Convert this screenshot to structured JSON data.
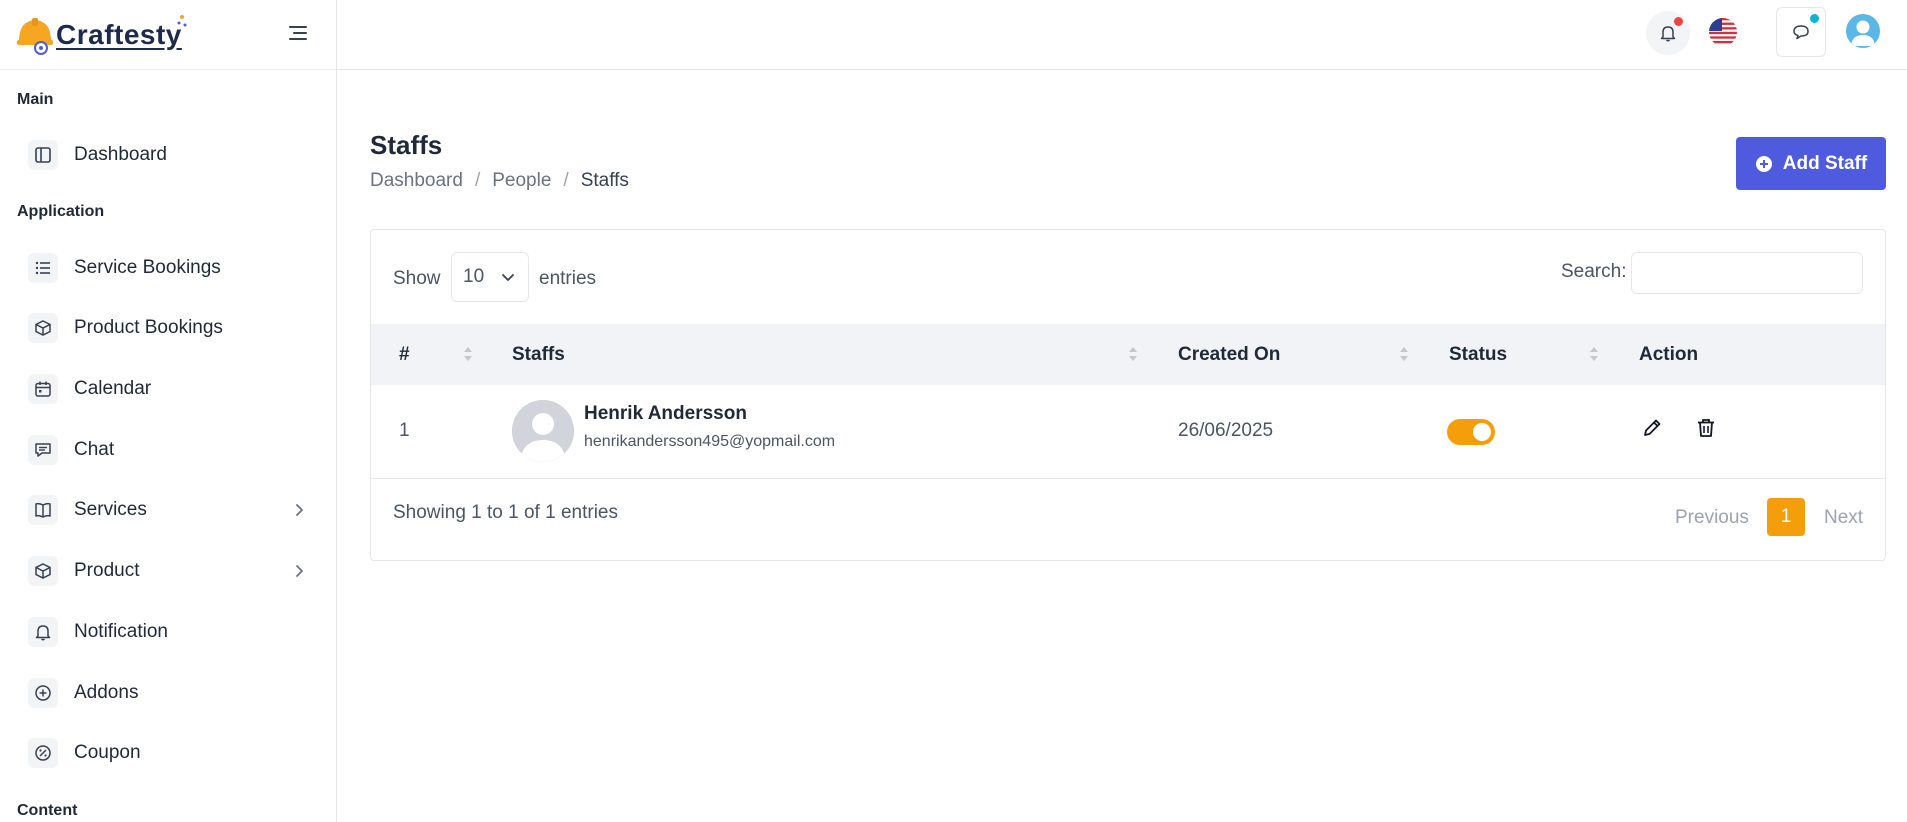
{
  "brand": {
    "name": "Craftesty"
  },
  "sidebar": {
    "sections": [
      {
        "title": "Main"
      },
      {
        "title": "Application"
      },
      {
        "title": "Content"
      }
    ],
    "items": [
      {
        "label": "Dashboard",
        "icon": "layout-icon"
      },
      {
        "label": "Service Bookings",
        "icon": "list-icon"
      },
      {
        "label": "Product Bookings",
        "icon": "box-icon"
      },
      {
        "label": "Calendar",
        "icon": "calendar-icon"
      },
      {
        "label": "Chat",
        "icon": "chat-icon"
      },
      {
        "label": "Services",
        "icon": "book-icon",
        "has_children": true
      },
      {
        "label": "Product",
        "icon": "box-icon",
        "has_children": true
      },
      {
        "label": "Notification",
        "icon": "bell-icon"
      },
      {
        "label": "Addons",
        "icon": "plus-circle-icon"
      },
      {
        "label": "Coupon",
        "icon": "percent-icon"
      }
    ]
  },
  "topbar": {
    "notification_dot_color": "#ef4444",
    "chat_dot_color": "#06b6d4"
  },
  "page": {
    "title": "Staffs",
    "breadcrumb": [
      "Dashboard",
      "People",
      "Staffs"
    ],
    "add_button_label": "Add Staff"
  },
  "table_controls": {
    "show_label": "Show",
    "entries_value": "10",
    "entries_label": "entries",
    "search_label": "Search:",
    "search_value": ""
  },
  "table": {
    "columns": [
      "#",
      "Staffs",
      "Created On",
      "Status",
      "Action"
    ],
    "rows": [
      {
        "index": "1",
        "name": "Henrik Andersson",
        "email": "henrikandersson495@yopmail.com",
        "created_on": "26/06/2025",
        "status_active": true
      }
    ]
  },
  "pagination": {
    "summary": "Showing 1 to 1 of 1 entries",
    "previous_label": "Previous",
    "current_page": "1",
    "next_label": "Next"
  },
  "colors": {
    "primary": "#4f5bdf",
    "accent": "#f59e0b"
  }
}
